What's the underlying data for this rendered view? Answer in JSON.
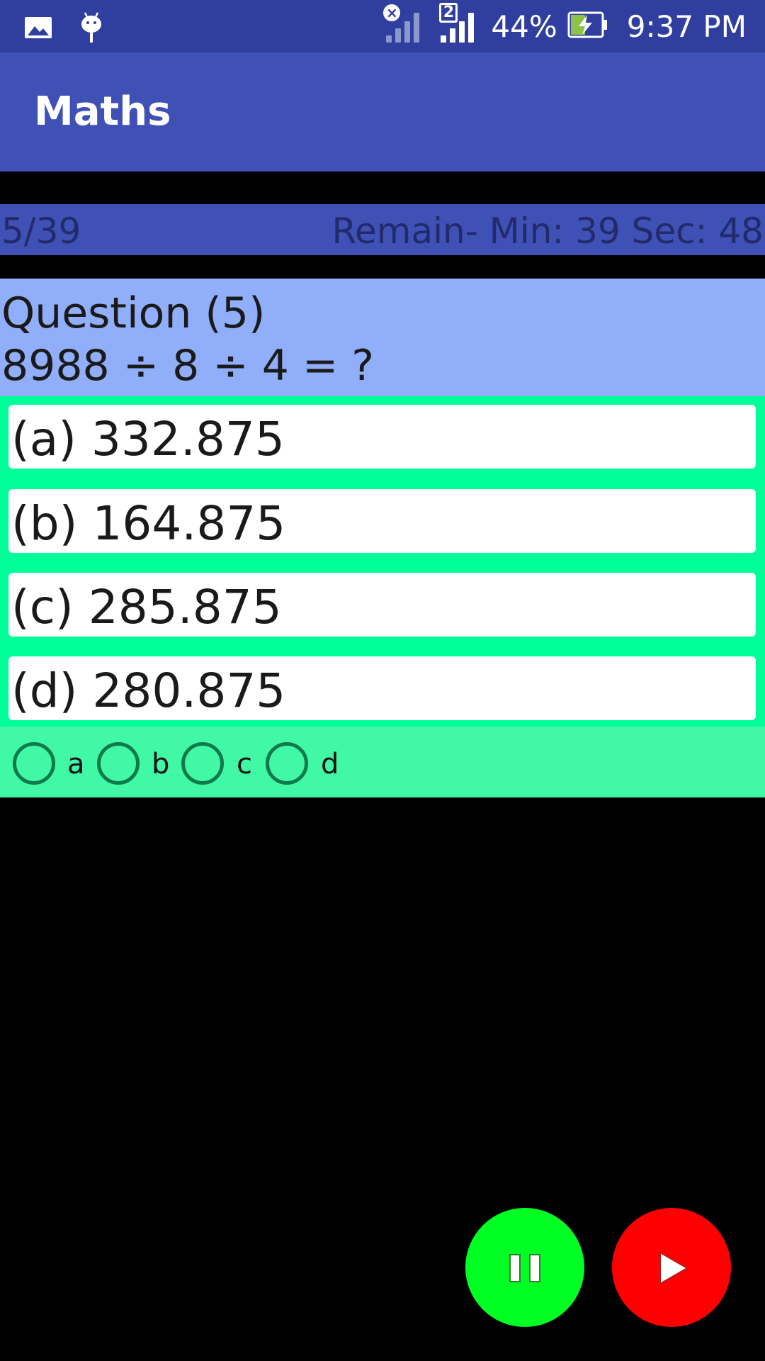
{
  "status_bar": {
    "battery": "44%",
    "time": "9:37 PM",
    "sim2_label": "2",
    "icons": [
      "gallery-icon",
      "android-debug-icon",
      "signal-no-sim-icon",
      "signal-sim2-icon",
      "battery-charging-icon"
    ]
  },
  "app_bar": {
    "title": "Maths"
  },
  "progress": {
    "count": "5/39",
    "remaining": "Remain- Min: 39 Sec: 48"
  },
  "question": {
    "title": "Question (5)",
    "text": "8988 ÷ 8 ÷ 4 = ?"
  },
  "options": [
    {
      "label": "(a) 332.875"
    },
    {
      "label": "(b) 164.875"
    },
    {
      "label": "(c) 285.875"
    },
    {
      "label": "(d) 280.875"
    }
  ],
  "answer_choices": [
    "a",
    "b",
    "c",
    "d"
  ],
  "colors": {
    "status_bar": "#303f9f",
    "app_bar": "#3f51b5",
    "question_bg": "#90aef9",
    "options_bg": "#00ff99",
    "pause_button": "#00ff22",
    "play_button": "#ff0000"
  },
  "buttons": {
    "pause_icon": "pause-icon",
    "play_icon": "play-icon"
  }
}
